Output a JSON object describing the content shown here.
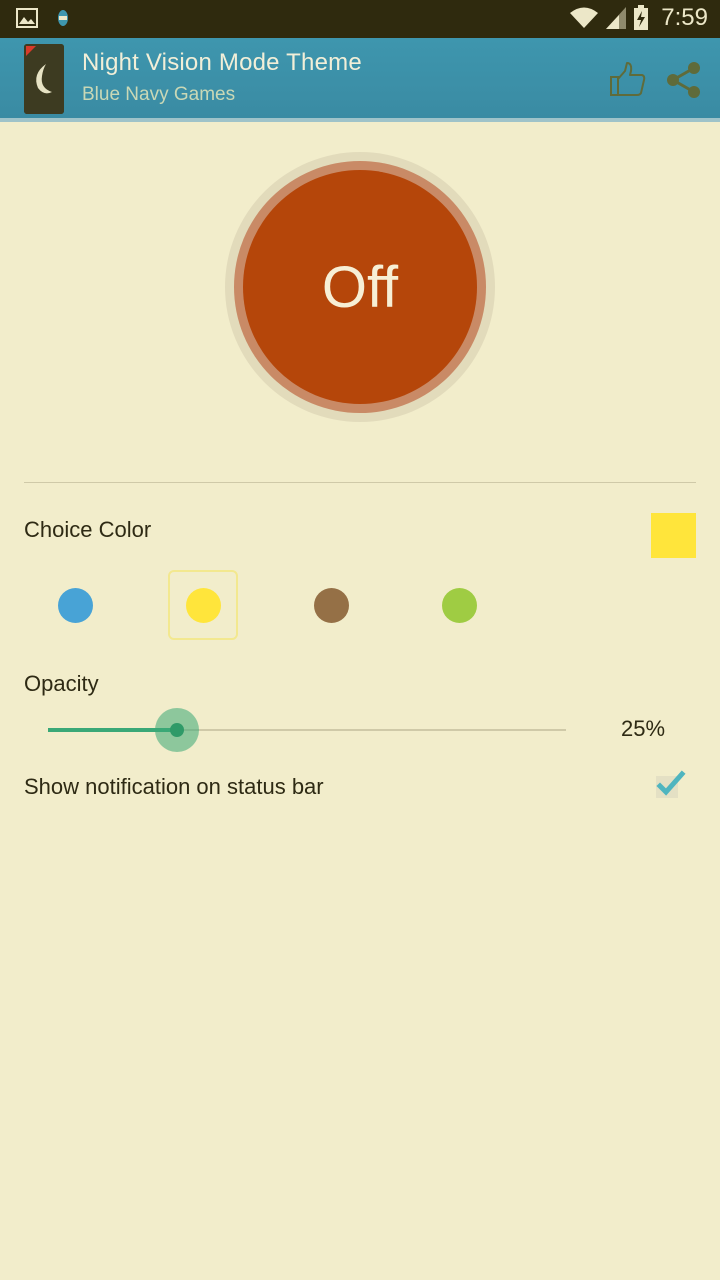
{
  "status_bar": {
    "time": "7:59",
    "left_icons": [
      "gallery-icon",
      "notification-app-icon"
    ],
    "right_icons": [
      "wifi-icon",
      "signal-icon",
      "battery-charging-icon"
    ]
  },
  "app_bar": {
    "title": "Night Vision Mode Theme",
    "subtitle": "Blue Navy Games",
    "actions": [
      "thumbs-up-icon",
      "share-icon"
    ]
  },
  "power_toggle": {
    "label": "Off"
  },
  "color_choice": {
    "label": "Choice Color",
    "selected_color": "#ffe53b",
    "options": [
      {
        "color": "#48a3d6",
        "selected": false
      },
      {
        "color": "#ffe53b",
        "selected": true
      },
      {
        "color": "#957046",
        "selected": false
      },
      {
        "color": "#9fcc43",
        "selected": false
      }
    ]
  },
  "opacity": {
    "label": "Opacity",
    "value_text": "25%",
    "value_percent": 25
  },
  "notification": {
    "label": "Show notification on status bar",
    "checked": true
  },
  "colors": {
    "background": "#f2edcb",
    "app_bar": "#3e96ae",
    "power_core": "#b5460a",
    "accent": "#3aa877"
  }
}
